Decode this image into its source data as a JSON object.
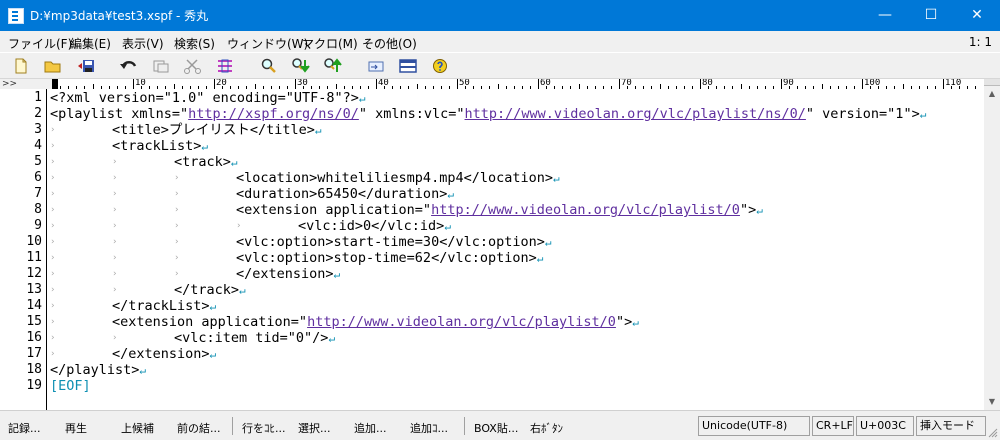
{
  "window": {
    "title": "D:¥mp3data¥test3.xspf - 秀丸",
    "minimize": "—",
    "maximize": "☐",
    "close": "✕"
  },
  "menu": {
    "items": [
      "ファイル(F)",
      "編集(E)",
      "表示(V)",
      "検索(S)",
      "ウィンドウ(W)",
      "マクロ(M)",
      "その他(O)"
    ],
    "position": "1: 1"
  },
  "toolbar": {
    "buttons": [
      "new-file-icon",
      "open-folder-icon",
      "save-icon",
      "undo-icon",
      "copy-icon",
      "cut-icon",
      "paste-icon",
      "search-icon",
      "search-down-icon",
      "search-up-icon",
      "jump-icon",
      "split-window-icon",
      "help-icon"
    ]
  },
  "ruler": {
    "left_label": ">>",
    "numbers": [
      "10",
      "20",
      "30",
      "40",
      "50",
      "60",
      "70",
      "80",
      "90",
      "100",
      "110"
    ]
  },
  "editor": {
    "lines": [
      {
        "n": "1",
        "indent": 0,
        "parts": [
          {
            "t": "<?xml version=\"1.0\" encoding=\"UTF-8\"?>"
          }
        ]
      },
      {
        "n": "2",
        "indent": 0,
        "parts": [
          {
            "t": "<playlist xmlns=\""
          },
          {
            "u": "http://xspf.org/ns/0/"
          },
          {
            "t": "\" xmlns:vlc=\""
          },
          {
            "u": "http://www.videolan.org/vlc/playlist/ns/0/"
          },
          {
            "t": "\" version=\"1\">"
          }
        ]
      },
      {
        "n": "3",
        "indent": 1,
        "parts": [
          {
            "t": "<title>プレイリスト</title>"
          }
        ]
      },
      {
        "n": "4",
        "indent": 1,
        "parts": [
          {
            "t": "<trackList>"
          }
        ]
      },
      {
        "n": "5",
        "indent": 2,
        "parts": [
          {
            "t": "<track>"
          }
        ]
      },
      {
        "n": "6",
        "indent": 3,
        "parts": [
          {
            "t": "<location>whiteliliesmp4.mp4</location>"
          }
        ]
      },
      {
        "n": "7",
        "indent": 3,
        "parts": [
          {
            "t": "<duration>65450</duration>"
          }
        ]
      },
      {
        "n": "8",
        "indent": 3,
        "parts": [
          {
            "t": "<extension application=\""
          },
          {
            "u": "http://www.videolan.org/vlc/playlist/0"
          },
          {
            "t": "\">"
          }
        ]
      },
      {
        "n": "9",
        "indent": 4,
        "parts": [
          {
            "t": "<vlc:id>0</vlc:id>"
          }
        ]
      },
      {
        "n": "10",
        "indent": 3,
        "parts": [
          {
            "t": "<vlc:option>start-time=30</vlc:option>"
          }
        ]
      },
      {
        "n": "11",
        "indent": 3,
        "parts": [
          {
            "t": "<vlc:option>stop-time=62</vlc:option>"
          }
        ]
      },
      {
        "n": "12",
        "indent": 3,
        "parts": [
          {
            "t": "</extension>"
          }
        ]
      },
      {
        "n": "13",
        "indent": 2,
        "parts": [
          {
            "t": "</track>"
          }
        ]
      },
      {
        "n": "14",
        "indent": 1,
        "parts": [
          {
            "t": "</trackList>"
          }
        ]
      },
      {
        "n": "15",
        "indent": 1,
        "parts": [
          {
            "t": "<extension application=\""
          },
          {
            "u": "http://www.videolan.org/vlc/playlist/0"
          },
          {
            "t": "\">"
          }
        ]
      },
      {
        "n": "16",
        "indent": 2,
        "parts": [
          {
            "t": "<vlc:item tid=\"0\"/>"
          }
        ]
      },
      {
        "n": "17",
        "indent": 1,
        "parts": [
          {
            "t": "</extension>"
          }
        ]
      },
      {
        "n": "18",
        "indent": 0,
        "parts": [
          {
            "t": "</playlist>"
          }
        ]
      }
    ],
    "eof_line_number": "19",
    "eof_marker": "[EOF]",
    "tab_glyph": "›",
    "newline_glyph": "↵"
  },
  "function_keys": [
    "記録...",
    "再生",
    "上候補",
    "前の結...",
    "行をｺﾋ...",
    "選択...",
    "追加...",
    "追加ｺ...",
    "BOX貼...",
    "右ﾎﾞﾀﾝ"
  ],
  "status": {
    "encoding": "Unicode(UTF-8)",
    "newline": "CR+LF",
    "char": "U+003C",
    "mode": "挿入モード"
  }
}
